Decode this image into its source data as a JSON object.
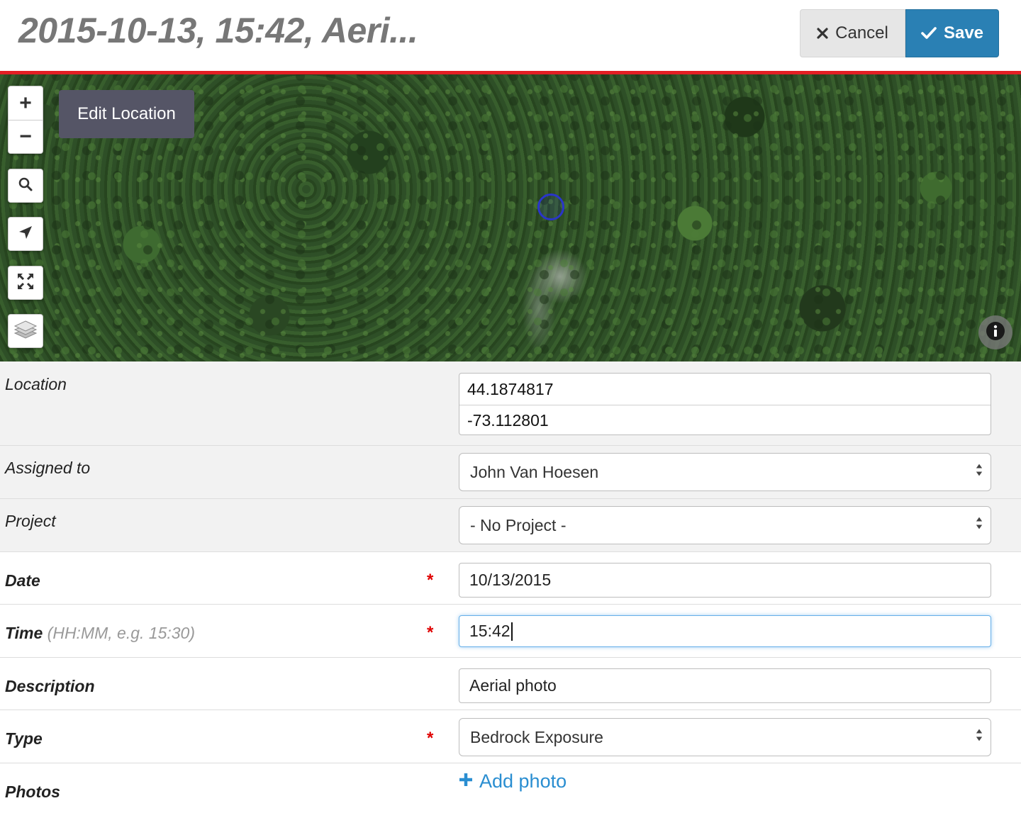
{
  "header": {
    "title": "2015-10-13, 15:42, Aeri...",
    "cancel_label": "Cancel",
    "save_label": "Save"
  },
  "map": {
    "edit_location_label": "Edit Location",
    "zoom_in_label": "+",
    "zoom_out_label": "−",
    "controls": [
      "search-icon",
      "locate-arrow-icon",
      "fullscreen-icon",
      "layers-icon"
    ],
    "info_icon": "info-icon",
    "marker_color": "#2a35c9"
  },
  "form": {
    "location": {
      "label": "Location",
      "latitude": "44.1874817",
      "longitude": "-73.112801"
    },
    "assigned_to": {
      "label": "Assigned to",
      "value": "John Van Hoesen"
    },
    "project": {
      "label": "Project",
      "value": "- No Project -"
    },
    "date": {
      "label": "Date",
      "required": "*",
      "value": "10/13/2015"
    },
    "time": {
      "label": "Time",
      "hint": "(HH:MM, e.g. 15:30)",
      "required": "*",
      "value": "15:42"
    },
    "description": {
      "label": "Description",
      "value": "Aerial photo"
    },
    "type": {
      "label": "Type",
      "required": "*",
      "value": "Bedrock Exposure"
    },
    "photos": {
      "label": "Photos",
      "add_label": "Add photo"
    }
  },
  "colors": {
    "accent_rule": "#e31e24",
    "save_button": "#2a80b4",
    "link": "#2a8ed1",
    "required": "#e00000"
  }
}
